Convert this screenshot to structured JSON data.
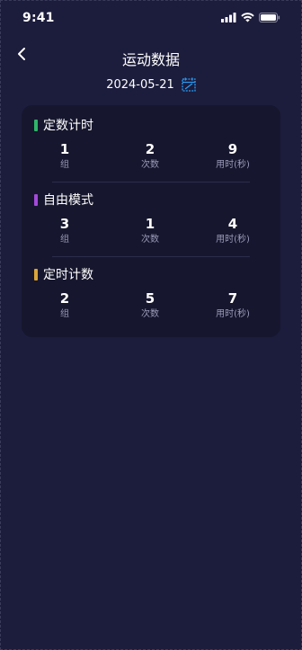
{
  "status_bar": {
    "time": "9:41"
  },
  "header": {
    "title": "运动数据"
  },
  "date": {
    "value": "2024-05-21"
  },
  "colors": {
    "background": "#1c1c3c",
    "card": "#16162e",
    "accent_blue": "#2a9df4"
  },
  "sections": [
    {
      "title": "定数计时",
      "bar_color": "#2fb56a",
      "stats": [
        {
          "value": "1",
          "label": "组"
        },
        {
          "value": "2",
          "label": "次数"
        },
        {
          "value": "9",
          "label": "用时(秒)"
        }
      ]
    },
    {
      "title": "自由模式",
      "bar_color": "#a24ad9",
      "stats": [
        {
          "value": "3",
          "label": "组"
        },
        {
          "value": "1",
          "label": "次数"
        },
        {
          "value": "4",
          "label": "用时(秒)"
        }
      ]
    },
    {
      "title": "定时计数",
      "bar_color": "#d9a43a",
      "stats": [
        {
          "value": "2",
          "label": "组"
        },
        {
          "value": "5",
          "label": "次数"
        },
        {
          "value": "7",
          "label": "用时(秒)"
        }
      ]
    }
  ]
}
